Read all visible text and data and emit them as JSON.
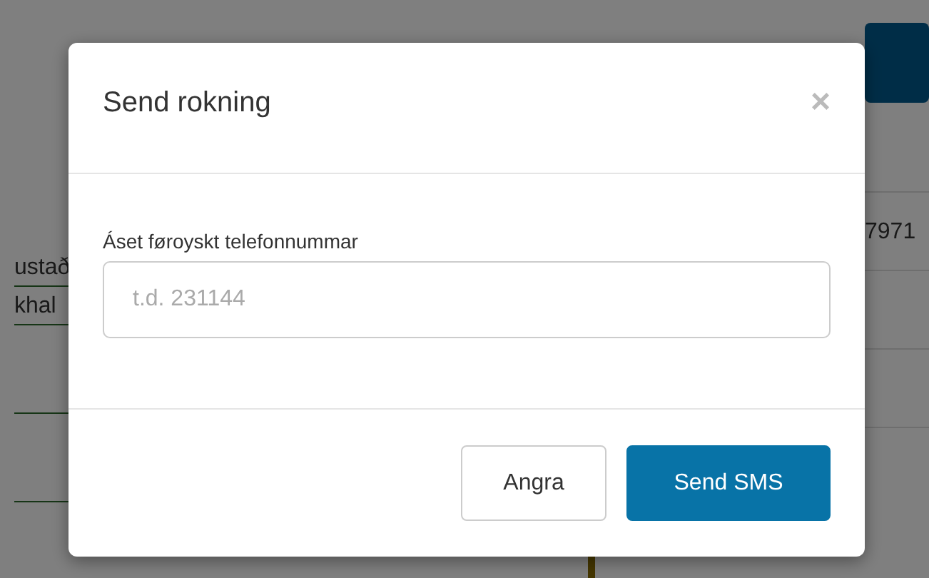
{
  "background": {
    "left_cells": [
      "ustað",
      "khal"
    ],
    "right_cells": [
      "7971"
    ]
  },
  "modal": {
    "title": "Send rokning",
    "close": "×",
    "field": {
      "label": "Áset føroyskt telefonnummar",
      "placeholder": "t.d. 231144"
    },
    "buttons": [
      {
        "label": "Angra",
        "kind": "secondary"
      },
      {
        "label": "Send SMS",
        "kind": "primary"
      }
    ]
  }
}
